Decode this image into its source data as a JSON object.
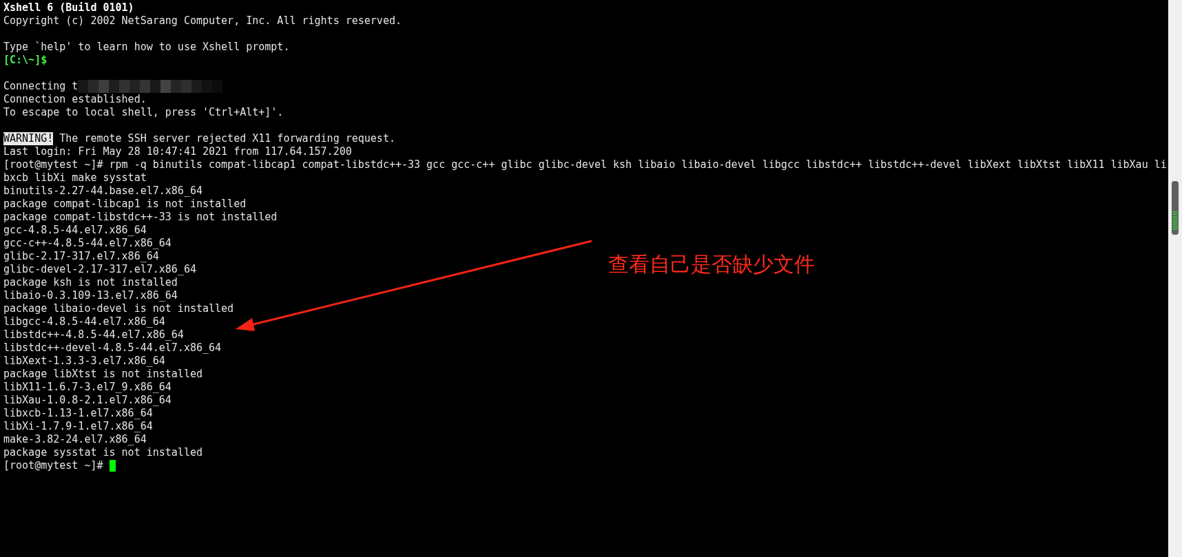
{
  "terminal": {
    "lines": [
      {
        "kind": "title",
        "text": "Xshell 6 (Build 0101)"
      },
      {
        "kind": "plain",
        "text": "Copyright (c) 2002 NetSarang Computer, Inc. All rights reserved."
      },
      {
        "kind": "blank"
      },
      {
        "kind": "plain",
        "text": "Type `help' to learn how to use Xshell prompt."
      },
      {
        "kind": "prompt",
        "text": "[C:\\~]$"
      },
      {
        "kind": "blank"
      },
      {
        "kind": "redacted",
        "text": "Connecting t"
      },
      {
        "kind": "plain",
        "text": "Connection established."
      },
      {
        "kind": "plain",
        "text": "To escape to local shell, press 'Ctrl+Alt+]'."
      },
      {
        "kind": "blank"
      },
      {
        "kind": "warning",
        "badge": "WARNING!",
        "text": " The remote SSH server rejected X11 forwarding request."
      },
      {
        "kind": "plain",
        "text": "Last login: Fri May 28 10:47:41 2021 from 117.64.157.200"
      },
      {
        "kind": "plain",
        "text": "[root@mytest ~]# rpm -q binutils compat-libcap1 compat-libstdc++-33 gcc gcc-c++ glibc glibc-devel ksh libaio libaio-devel libgcc libstdc++ libstdc++-devel libXext libXtst libX11 libXau li"
      },
      {
        "kind": "plain",
        "text": "bxcb libXi make sysstat"
      },
      {
        "kind": "plain",
        "text": "binutils-2.27-44.base.el7.x86_64"
      },
      {
        "kind": "plain",
        "text": "package compat-libcap1 is not installed"
      },
      {
        "kind": "plain",
        "text": "package compat-libstdc++-33 is not installed"
      },
      {
        "kind": "plain",
        "text": "gcc-4.8.5-44.el7.x86_64"
      },
      {
        "kind": "plain",
        "text": "gcc-c++-4.8.5-44.el7.x86_64"
      },
      {
        "kind": "plain",
        "text": "glibc-2.17-317.el7.x86_64"
      },
      {
        "kind": "plain",
        "text": "glibc-devel-2.17-317.el7.x86_64"
      },
      {
        "kind": "plain",
        "text": "package ksh is not installed"
      },
      {
        "kind": "plain",
        "text": "libaio-0.3.109-13.el7.x86_64"
      },
      {
        "kind": "plain",
        "text": "package libaio-devel is not installed"
      },
      {
        "kind": "plain",
        "text": "libgcc-4.8.5-44.el7.x86_64"
      },
      {
        "kind": "plain",
        "text": "libstdc++-4.8.5-44.el7.x86_64"
      },
      {
        "kind": "plain",
        "text": "libstdc++-devel-4.8.5-44.el7.x86_64"
      },
      {
        "kind": "plain",
        "text": "libXext-1.3.3-3.el7.x86_64"
      },
      {
        "kind": "plain",
        "text": "package libXtst is not installed"
      },
      {
        "kind": "plain",
        "text": "libX11-1.6.7-3.el7_9.x86_64"
      },
      {
        "kind": "plain",
        "text": "libXau-1.0.8-2.1.el7.x86_64"
      },
      {
        "kind": "plain",
        "text": "libxcb-1.13-1.el7.x86_64"
      },
      {
        "kind": "plain",
        "text": "libXi-1.7.9-1.el7.x86_64"
      },
      {
        "kind": "plain",
        "text": "make-3.82-24.el7.x86_64"
      },
      {
        "kind": "plain",
        "text": "package sysstat is not installed"
      },
      {
        "kind": "cursor",
        "text": "[root@mytest ~]# "
      }
    ]
  },
  "annotation": {
    "text": "查看自己是否缺少文件"
  }
}
